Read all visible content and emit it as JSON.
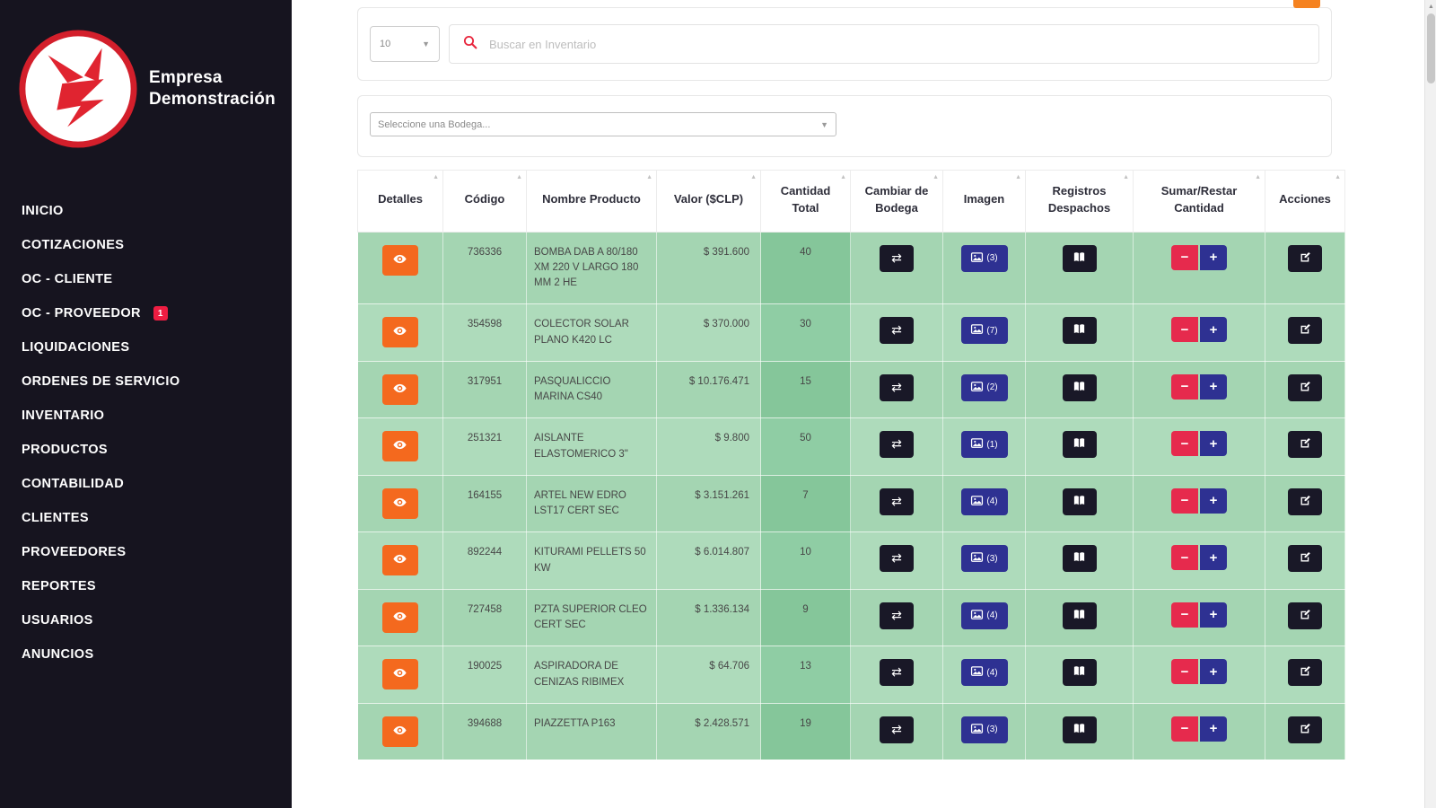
{
  "sidebar": {
    "company_name_line1": "Empresa",
    "company_name_line2": "Demonstración",
    "items": [
      {
        "label": "INICIO"
      },
      {
        "label": "COTIZACIONES"
      },
      {
        "label": "OC - CLIENTE"
      },
      {
        "label": "OC - PROVEEDOR",
        "badge": "1"
      },
      {
        "label": "LIQUIDACIONES"
      },
      {
        "label": "ORDENES DE SERVICIO"
      },
      {
        "label": "INVENTARIO"
      },
      {
        "label": "PRODUCTOS"
      },
      {
        "label": "CONTABILIDAD"
      },
      {
        "label": "CLIENTES"
      },
      {
        "label": "PROVEEDORES"
      },
      {
        "label": "REPORTES"
      },
      {
        "label": "USUARIOS"
      },
      {
        "label": "ANUNCIOS"
      }
    ]
  },
  "toolbar": {
    "page_size_value": "10",
    "search_placeholder": "Buscar en Inventario",
    "caret": "▼"
  },
  "bodega_select": {
    "value": "Seleccione una Bodega...",
    "caret": "▼"
  },
  "table": {
    "sort_icon": "▲",
    "headers": [
      "Detalles",
      "Código",
      "Nombre Producto",
      "Valor ($CLP)",
      "Cantidad Total",
      "Cambiar de Bodega",
      "Imagen",
      "Registros Despachos",
      "Sumar/Restar Cantidad",
      "Acciones"
    ],
    "controls": {
      "minus_label": "−",
      "plus_label": "+",
      "transfer_icon": "⇄"
    },
    "rows": [
      {
        "codigo": "736336",
        "nombre": "BOMBA DAB A 80/180 XM 220 V LARGO 180 MM 2 HE",
        "valor": "$ 391.600",
        "cantidad": "40",
        "imagenes": "(3)"
      },
      {
        "codigo": "354598",
        "nombre": "COLECTOR SOLAR PLANO K420 LC",
        "valor": "$ 370.000",
        "cantidad": "30",
        "imagenes": "(7)"
      },
      {
        "codigo": "317951",
        "nombre": "PASQUALICCIO MARINA CS40",
        "valor": "$ 10.176.471",
        "cantidad": "15",
        "imagenes": "(2)"
      },
      {
        "codigo": "251321",
        "nombre": "AISLANTE ELASTOMERICO 3\"",
        "valor": "$ 9.800",
        "cantidad": "50",
        "imagenes": "(1)"
      },
      {
        "codigo": "164155",
        "nombre": "ARTEL NEW EDRO LST17 CERT SEC",
        "valor": "$ 3.151.261",
        "cantidad": "7",
        "imagenes": "(4)"
      },
      {
        "codigo": "892244",
        "nombre": "KITURAMI PELLETS 50 KW",
        "valor": "$ 6.014.807",
        "cantidad": "10",
        "imagenes": "(3)"
      },
      {
        "codigo": "727458",
        "nombre": "PZTA SUPERIOR CLEO CERT SEC",
        "valor": "$ 1.336.134",
        "cantidad": "9",
        "imagenes": "(4)"
      },
      {
        "codigo": "190025",
        "nombre": "ASPIRADORA DE CENIZAS RIBIMEX",
        "valor": "$ 64.706",
        "cantidad": "13",
        "imagenes": "(4)"
      },
      {
        "codigo": "394688",
        "nombre": "PIAZZETTA P163",
        "valor": "$ 2.428.571",
        "cantidad": "19",
        "imagenes": "(3)"
      }
    ]
  },
  "scrollbar": {
    "up_arrow": "▲"
  },
  "colors": {
    "sidebar_bg": "#16141f",
    "accent_orange": "#f4691e",
    "accent_indigo": "#2e3192",
    "accent_red": "#e62a4d",
    "badge_red": "#ee1d42",
    "row_green": "#a4d5b2",
    "qty_green": "#85c69a",
    "logo_red": "#d31f2b"
  }
}
